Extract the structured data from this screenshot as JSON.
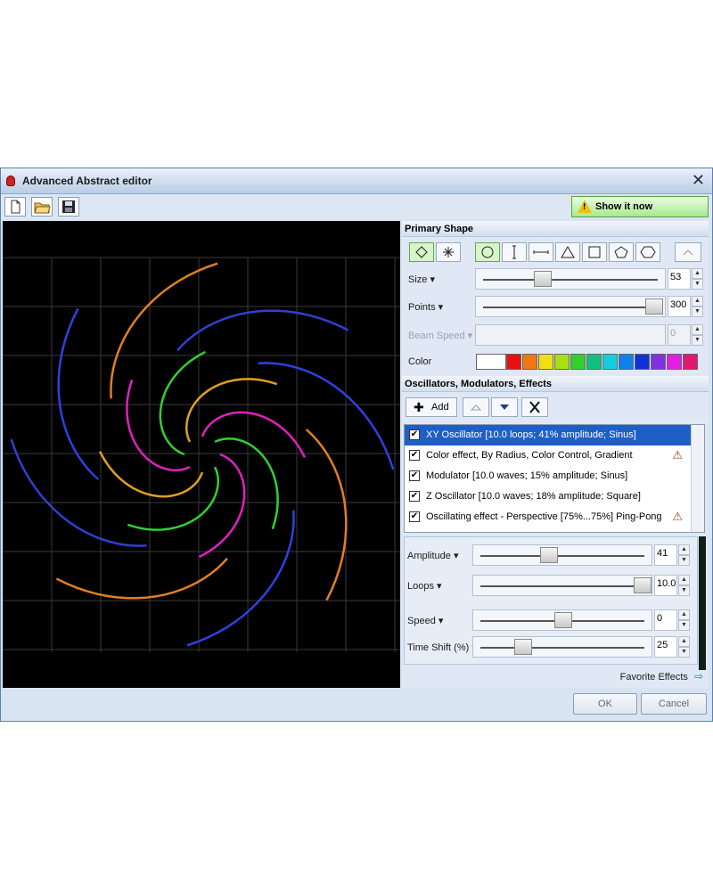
{
  "window": {
    "title": "Advanced Abstract editor",
    "close_glyph": "✕"
  },
  "toolbar": {
    "icons": [
      "new-file-icon",
      "open-folder-icon",
      "save-disk-icon"
    ],
    "show_now_label": "Show it now"
  },
  "primary_shape": {
    "header": "Primary Shape",
    "size": {
      "label": "Size",
      "value": "53",
      "level": 0.25
    },
    "points": {
      "label": "Points",
      "value": "300",
      "level": 1.0
    },
    "beam_speed": {
      "label": "Beam Speed",
      "value": "0",
      "level": 0
    },
    "color_label": "Color",
    "palette": [
      "#ffffff",
      "#e81010",
      "#f07810",
      "#f0e010",
      "#a8e010",
      "#30d030",
      "#10c080",
      "#10d0e0",
      "#1080f0",
      "#1030d8",
      "#8030e0",
      "#e020e0",
      "#e01870"
    ]
  },
  "oscillators": {
    "header": "Oscillators, Modulators, Effects",
    "add_label": "Add",
    "items": [
      {
        "label": "XY Oscillator [10.0 loops; 41% amplitude; Sinus]",
        "checked": "✔",
        "selected": true
      },
      {
        "label": "Color effect, By Radius, Color Control, Gradient",
        "checked": "✔",
        "mod": "⚠"
      },
      {
        "label": "Modulator [10.0 waves; 15% amplitude; Sinus]",
        "checked": "✔"
      },
      {
        "label": "Z Oscillator [10.0 waves; 18% amplitude; Square]",
        "checked": "✔"
      },
      {
        "label": "Oscillating effect - Perspective [75%...75%] Ping-Pong",
        "checked": "✔",
        "mod": "⚠"
      }
    ]
  },
  "params": {
    "amplitude": {
      "label": "Amplitude",
      "value": "41",
      "level": 0.41
    },
    "loops": {
      "label": "Loops",
      "value": "10.0",
      "level": 1.0
    },
    "speed": {
      "label": "Speed",
      "value": "0",
      "level": 0.5
    },
    "time_shift": {
      "label": "Time Shift (%)",
      "value": "25",
      "level": 0.25
    }
  },
  "favorite_label": "Favorite Effects",
  "buttons": {
    "ok": "OK",
    "cancel": "Cancel"
  }
}
